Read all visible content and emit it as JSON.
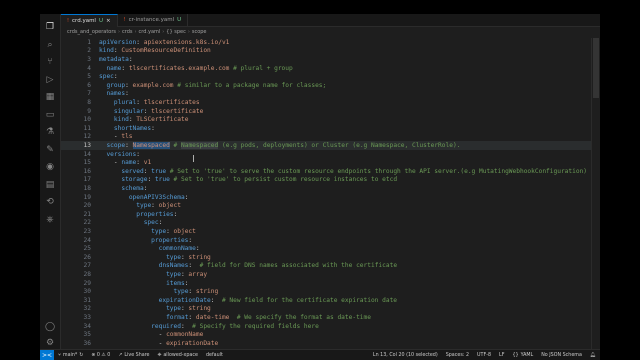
{
  "tabs": [
    {
      "label": "crd.yaml",
      "marker": "U",
      "active": true
    },
    {
      "label": "cr-instance.yaml",
      "marker": "U",
      "active": false
    }
  ],
  "breadcrumb": [
    "crds_and_operators",
    "crds",
    "crd.yaml",
    "{} spec",
    "scope"
  ],
  "activity_icons": [
    "explorer-icon",
    "search-icon",
    "source-control-icon",
    "run-debug-icon",
    "extensions-icon",
    "remote-explorer-icon",
    "testing-icon",
    "tools-icon",
    "chrome-icon",
    "docker-icon",
    "git-graph-icon",
    "kubernetes-icon",
    "account-icon",
    "settings-icon"
  ],
  "code": [
    {
      "n": "1",
      "t": [
        [
          "k",
          "apiVersion"
        ],
        [
          "p",
          ": "
        ],
        [
          "v",
          "apiextensions.k8s.io/v1"
        ]
      ]
    },
    {
      "n": "2",
      "t": [
        [
          "k",
          "kind"
        ],
        [
          "p",
          ": "
        ],
        [
          "v",
          "CustomResourceDefinition"
        ]
      ]
    },
    {
      "n": "3",
      "t": [
        [
          "k",
          "metadata"
        ],
        [
          "p",
          ":"
        ]
      ]
    },
    {
      "n": "4",
      "t": [
        [
          "p",
          "  "
        ],
        [
          "k",
          "name"
        ],
        [
          "p",
          ": "
        ],
        [
          "v",
          "tlscertificates.example.com "
        ],
        [
          "c",
          "# plural + group"
        ]
      ]
    },
    {
      "n": "5",
      "t": [
        [
          "k",
          "spec"
        ],
        [
          "p",
          ":"
        ]
      ]
    },
    {
      "n": "6",
      "t": [
        [
          "p",
          "  "
        ],
        [
          "k",
          "group"
        ],
        [
          "p",
          ": "
        ],
        [
          "v",
          "example.com "
        ],
        [
          "c",
          "# similar to a package name for classes;"
        ]
      ]
    },
    {
      "n": "7",
      "t": [
        [
          "p",
          "  "
        ],
        [
          "k",
          "names"
        ],
        [
          "p",
          ":"
        ]
      ]
    },
    {
      "n": "8",
      "t": [
        [
          "p",
          "    "
        ],
        [
          "k",
          "plural"
        ],
        [
          "p",
          ": "
        ],
        [
          "v",
          "tlscertificates"
        ]
      ]
    },
    {
      "n": "9",
      "t": [
        [
          "p",
          "    "
        ],
        [
          "k",
          "singular"
        ],
        [
          "p",
          ": "
        ],
        [
          "v",
          "tlscertificate"
        ]
      ]
    },
    {
      "n": "10",
      "t": [
        [
          "p",
          "    "
        ],
        [
          "k",
          "kind"
        ],
        [
          "p",
          ": "
        ],
        [
          "v",
          "TLSCertificate"
        ]
      ]
    },
    {
      "n": "11",
      "t": [
        [
          "p",
          "    "
        ],
        [
          "k",
          "shortNames"
        ],
        [
          "p",
          ":"
        ]
      ]
    },
    {
      "n": "12",
      "t": [
        [
          "p",
          "    - "
        ],
        [
          "v",
          "tls"
        ]
      ]
    },
    {
      "n": "13",
      "t": [
        [
          "p",
          "  "
        ],
        [
          "k",
          "scope"
        ],
        [
          "p",
          ": "
        ],
        [
          "vh",
          "Namespaced"
        ],
        [
          "c",
          " # "
        ],
        [
          "ch",
          "Namespaced"
        ],
        [
          "c",
          " (e.g pods, deployments) or Cluster (e.g Namespace, ClusterRole)."
        ]
      ],
      "current": true
    },
    {
      "n": "14",
      "t": [
        [
          "p",
          "  "
        ],
        [
          "k",
          "versions"
        ],
        [
          "p",
          ":"
        ]
      ]
    },
    {
      "n": "15",
      "t": [
        [
          "p",
          "    - "
        ],
        [
          "k",
          "name"
        ],
        [
          "p",
          ": "
        ],
        [
          "v",
          "v1"
        ]
      ]
    },
    {
      "n": "16",
      "t": [
        [
          "p",
          "      "
        ],
        [
          "k",
          "served"
        ],
        [
          "p",
          ": "
        ],
        [
          "k",
          "true "
        ],
        [
          "c",
          "# Set to 'true' to serve the custom resource endpoints through the API server.(e.g MutatingWebhookConfiguration)"
        ]
      ]
    },
    {
      "n": "17",
      "t": [
        [
          "p",
          "      "
        ],
        [
          "k",
          "storage"
        ],
        [
          "p",
          ": "
        ],
        [
          "k",
          "true "
        ],
        [
          "c",
          "# Set to 'true' to persist custom resource instances to etcd"
        ]
      ]
    },
    {
      "n": "18",
      "t": [
        [
          "p",
          "      "
        ],
        [
          "k",
          "schema"
        ],
        [
          "p",
          ":"
        ]
      ]
    },
    {
      "n": "19",
      "t": [
        [
          "p",
          "        "
        ],
        [
          "k",
          "openAPIV3Schema"
        ],
        [
          "p",
          ":"
        ]
      ]
    },
    {
      "n": "20",
      "t": [
        [
          "p",
          "          "
        ],
        [
          "k",
          "type"
        ],
        [
          "p",
          ": "
        ],
        [
          "v",
          "object"
        ]
      ]
    },
    {
      "n": "21",
      "t": [
        [
          "p",
          "          "
        ],
        [
          "k",
          "properties"
        ],
        [
          "p",
          ":"
        ]
      ]
    },
    {
      "n": "22",
      "t": [
        [
          "p",
          "            "
        ],
        [
          "k",
          "spec"
        ],
        [
          "p",
          ":"
        ]
      ]
    },
    {
      "n": "23",
      "t": [
        [
          "p",
          "              "
        ],
        [
          "k",
          "type"
        ],
        [
          "p",
          ": "
        ],
        [
          "v",
          "object"
        ]
      ]
    },
    {
      "n": "24",
      "t": [
        [
          "p",
          "              "
        ],
        [
          "k",
          "properties"
        ],
        [
          "p",
          ":"
        ]
      ]
    },
    {
      "n": "25",
      "t": [
        [
          "p",
          "                "
        ],
        [
          "k",
          "commonName"
        ],
        [
          "p",
          ":"
        ]
      ]
    },
    {
      "n": "26",
      "t": [
        [
          "p",
          "                  "
        ],
        [
          "k",
          "type"
        ],
        [
          "p",
          ": "
        ],
        [
          "v",
          "string"
        ]
      ]
    },
    {
      "n": "27",
      "t": [
        [
          "p",
          "                "
        ],
        [
          "k",
          "dnsNames"
        ],
        [
          "p",
          ":  "
        ],
        [
          "c",
          "# field for DNS names associated with the certificate"
        ]
      ]
    },
    {
      "n": "28",
      "t": [
        [
          "p",
          "                  "
        ],
        [
          "k",
          "type"
        ],
        [
          "p",
          ": "
        ],
        [
          "v",
          "array"
        ]
      ]
    },
    {
      "n": "29",
      "t": [
        [
          "p",
          "                  "
        ],
        [
          "k",
          "items"
        ],
        [
          "p",
          ":"
        ]
      ]
    },
    {
      "n": "30",
      "t": [
        [
          "p",
          "                    "
        ],
        [
          "k",
          "type"
        ],
        [
          "p",
          ": "
        ],
        [
          "v",
          "string"
        ]
      ]
    },
    {
      "n": "31",
      "t": [
        [
          "p",
          "                "
        ],
        [
          "k",
          "expirationDate"
        ],
        [
          "p",
          ":  "
        ],
        [
          "c",
          "# New field for the certificate expiration date"
        ]
      ]
    },
    {
      "n": "32",
      "t": [
        [
          "p",
          "                  "
        ],
        [
          "k",
          "type"
        ],
        [
          "p",
          ": "
        ],
        [
          "v",
          "string"
        ]
      ]
    },
    {
      "n": "33",
      "t": [
        [
          "p",
          "                  "
        ],
        [
          "k",
          "format"
        ],
        [
          "p",
          ": "
        ],
        [
          "v",
          "date-time  "
        ],
        [
          "c",
          "# We specify the format as date-time"
        ]
      ]
    },
    {
      "n": "34",
      "t": [
        [
          "p",
          "              "
        ],
        [
          "k",
          "required"
        ],
        [
          "p",
          ":  "
        ],
        [
          "c",
          "# Specify the required fields here"
        ]
      ]
    },
    {
      "n": "35",
      "t": [
        [
          "p",
          "                - "
        ],
        [
          "v",
          "commonName"
        ]
      ]
    },
    {
      "n": "36",
      "t": [
        [
          "p",
          "                - "
        ],
        [
          "v",
          "expirationDate"
        ]
      ]
    }
  ],
  "status": {
    "remote": "><",
    "branch": "main*",
    "sync": "↻",
    "errors": "⊗ 0 ⚠ 0",
    "live_share": "Live Share",
    "workspace": "allowed-xpace",
    "default": "default",
    "position": "Ln 13, Col 20 (10 selected)",
    "spaces": "Spaces: 2",
    "encoding": "UTF-8",
    "eol": "LF",
    "language": "YAML",
    "schema": "No JSON Schema"
  },
  "colors": {
    "accent": "#0078d4",
    "key": "#569cd6",
    "string": "#ce9178",
    "comment": "#6a9955"
  }
}
